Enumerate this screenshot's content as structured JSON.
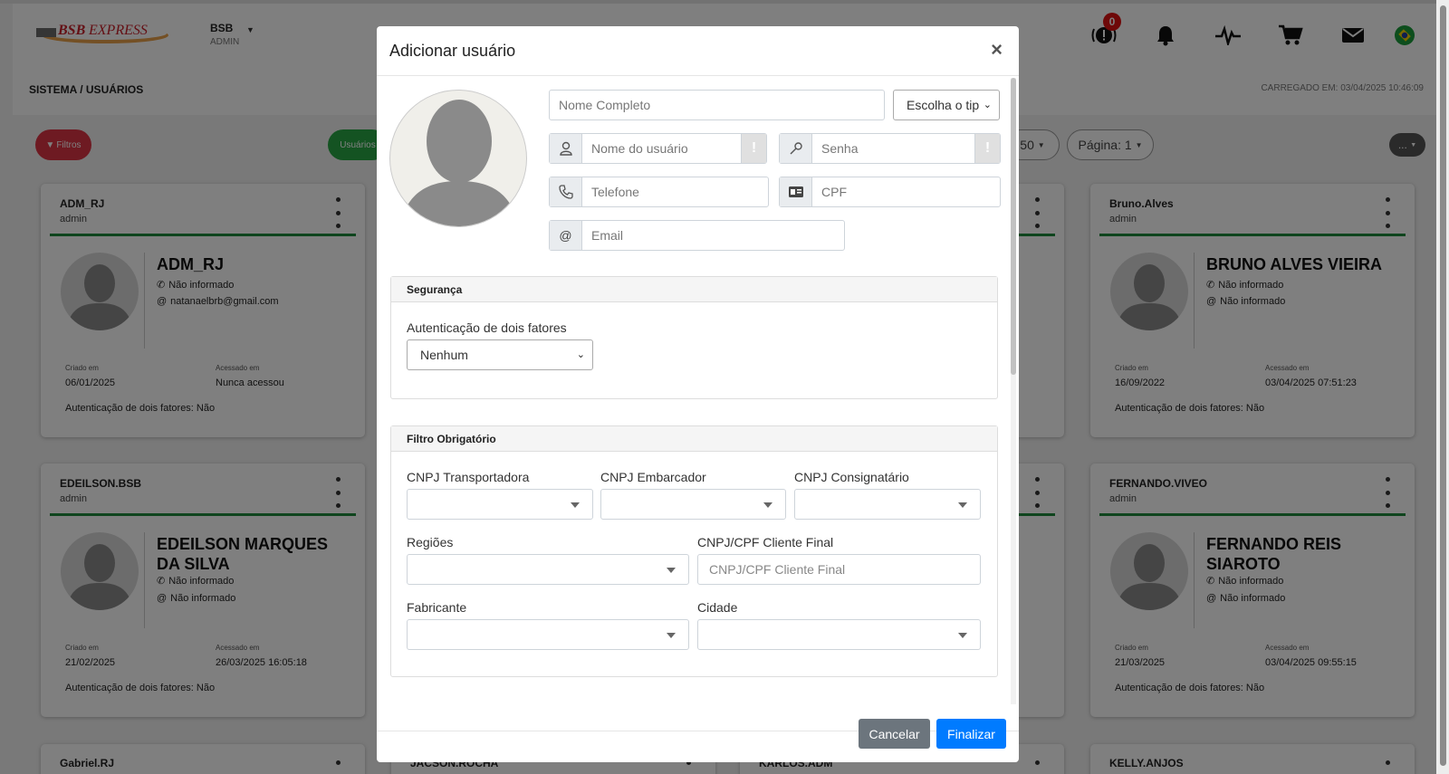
{
  "header": {
    "logo_text": "BSB EXPRESS",
    "user_name": "BSB",
    "user_role": "ADMIN",
    "notification_count": "0"
  },
  "subbar": {
    "breadcrumb": "SISTEMA / USUÁRIOS",
    "loaded_at": "CARREGADO EM: 03/04/2025 10:46:09"
  },
  "toolbar": {
    "filters_label": "Filtros",
    "users_label": "Usuários",
    "page_size_label": "50",
    "page_label": "Página: 1",
    "more_label": "..."
  },
  "cards": [
    {
      "username": "ADM_RJ",
      "role": "admin",
      "full_name": "ADM_RJ",
      "phone": "Não informado",
      "email": "natanaelbrb@gmail.com",
      "created_label": "Criado em",
      "created": "06/01/2025",
      "accessed_label": "Acessado em",
      "accessed": "Nunca acessou",
      "twofa": "Autenticação de dois fatores: Não"
    },
    {
      "username": "Bruno.Alves",
      "role": "admin",
      "full_name": "BRUNO ALVES VIEIRA",
      "phone": "Não informado",
      "email": "Não informado",
      "created_label": "Criado em",
      "created": "16/09/2022",
      "accessed_label": "Acessado em",
      "accessed": "03/04/2025 07:51:23",
      "twofa": "Autenticação de dois fatores: Não"
    },
    {
      "username": "EDEILSON.BSB",
      "role": "admin",
      "full_name": "EDEILSON MARQUES DA SILVA",
      "phone": "Não informado",
      "email": "Não informado",
      "created_label": "Criado em",
      "created": "21/02/2025",
      "accessed_label": "Acessado em",
      "accessed": "26/03/2025 16:05:18",
      "twofa": "Autenticação de dois fatores: Não"
    },
    {
      "username": "FERNANDO.VIVEO",
      "role": "admin",
      "full_name": "FERNANDO REIS SIAROTO",
      "phone": "Não informado",
      "email": "Não informado",
      "created_label": "Criado em",
      "created": "21/03/2025",
      "accessed_label": "Acessado em",
      "accessed": "03/04/2025 09:55:15",
      "twofa": "Autenticação de dois fatores: Não"
    },
    {
      "username": "Gabriel.RJ"
    },
    {
      "username": "JACSON.ROCHA"
    },
    {
      "username": "KARLOS.ADM"
    },
    {
      "username": "KELLY.ANJOS"
    }
  ],
  "modal": {
    "title": "Adicionar usuário",
    "close": "×",
    "full_name_placeholder": "Nome Completo",
    "type_select": "Escolha o tip",
    "username_placeholder": "Nome do usuário",
    "password_placeholder": "Senha",
    "phone_placeholder": "Telefone",
    "cpf_placeholder": "CPF",
    "email_placeholder": "Email",
    "warn_glyph": "!",
    "security": {
      "title": "Segurança",
      "twofa_label": "Autenticação de dois fatores",
      "twofa_value": "Nenhum"
    },
    "filter": {
      "title": "Filtro Obrigatório",
      "cnpj_transportadora": "CNPJ Transportadora",
      "cnpj_embarcador": "CNPJ Embarcador",
      "cnpj_consignatario": "CNPJ Consignatário",
      "regioes": "Regiões",
      "cliente_final_label": "CNPJ/CPF Cliente Final",
      "cliente_final_placeholder": "CNPJ/CPF Cliente Final",
      "fabricante": "Fabricante",
      "cidade": "Cidade"
    },
    "cancel": "Cancelar",
    "finish": "Finalizar"
  },
  "colors": {
    "danger": "#dc3545",
    "success": "#28a745",
    "primary": "#007bff",
    "secondary": "#6c757d",
    "card_accent": "#1e8a3c"
  }
}
